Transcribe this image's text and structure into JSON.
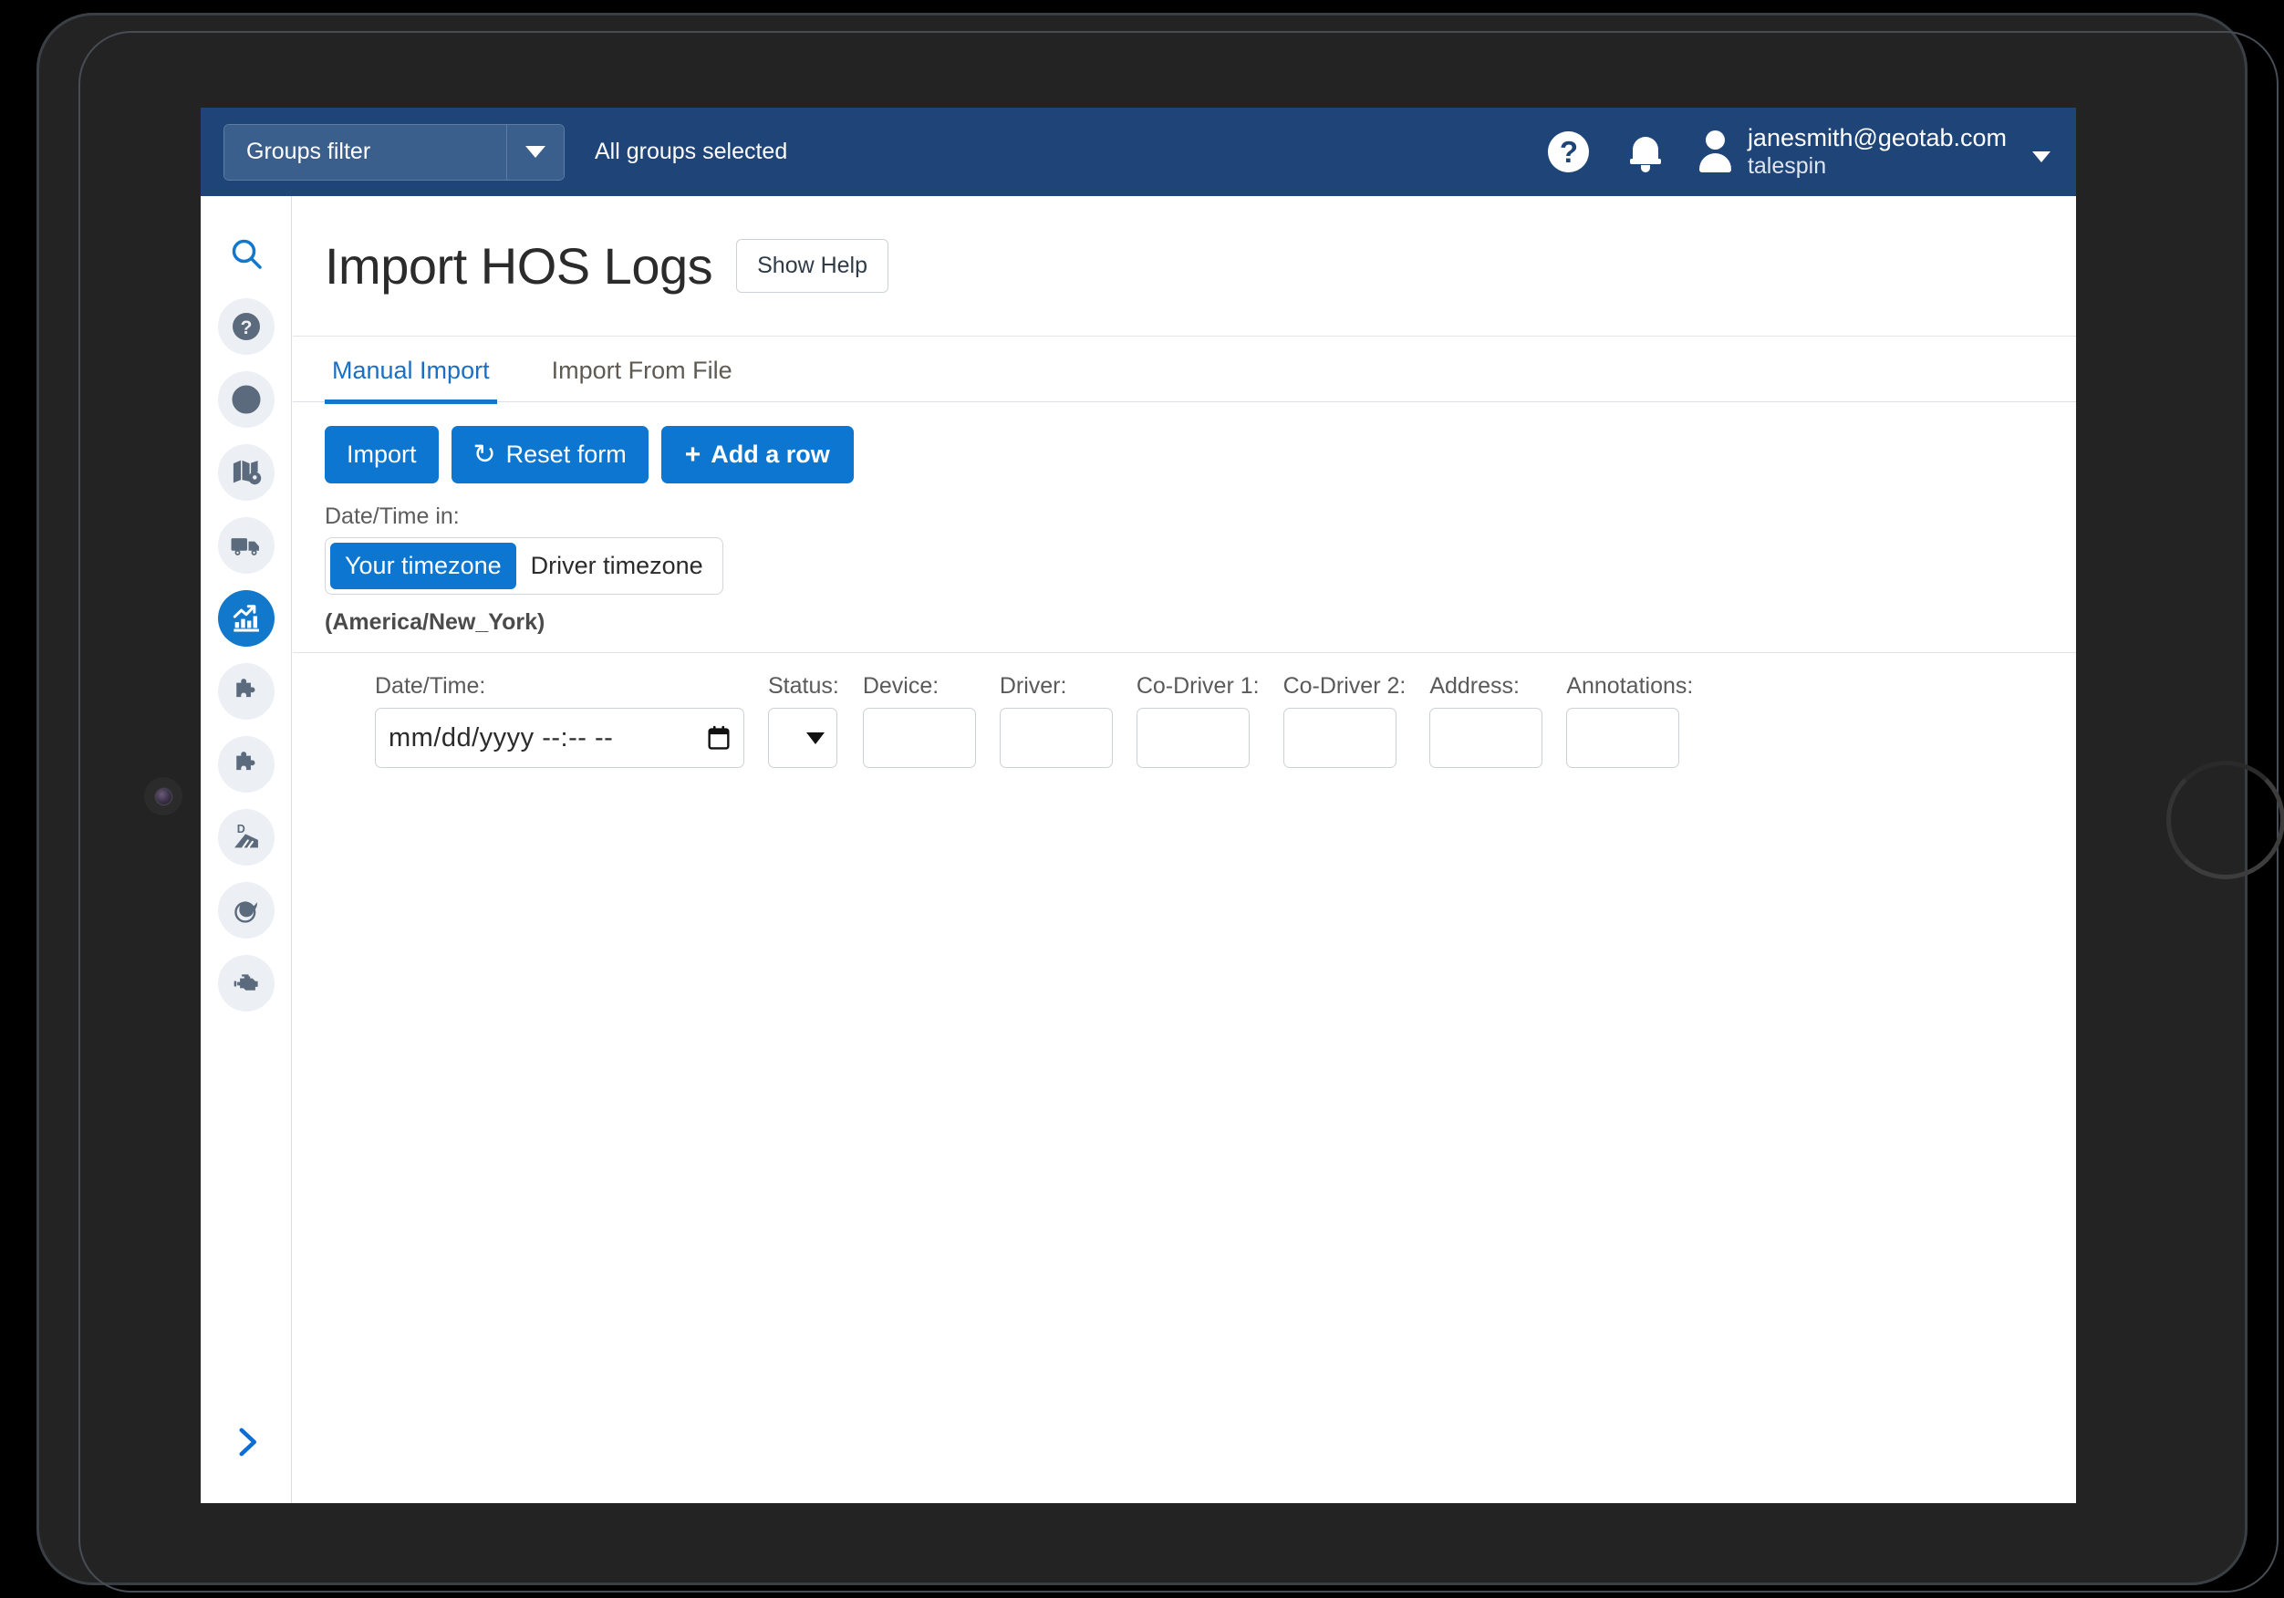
{
  "header": {
    "groups_filter_label": "Groups filter",
    "groups_selected_text": "All groups selected",
    "help_icon": "question-mark-circle-icon",
    "bell_icon": "notification-bell-icon",
    "user_email": "janesmith@geotab.com",
    "user_database": "talespin",
    "accent_blue": "#1f4477"
  },
  "sidebar": {
    "items": [
      {
        "name": "search",
        "icon": "search-icon",
        "active": false,
        "plain": true
      },
      {
        "name": "help",
        "icon": "help-circle-icon",
        "active": false,
        "plain": false
      },
      {
        "name": "dashboard",
        "icon": "pie-chart-icon",
        "active": false,
        "plain": false
      },
      {
        "name": "map",
        "icon": "map-pin-icon",
        "active": false,
        "plain": false
      },
      {
        "name": "vehicles",
        "icon": "truck-icon",
        "active": false,
        "plain": false
      },
      {
        "name": "reports",
        "icon": "bar-chart-up-icon",
        "active": true,
        "plain": false
      },
      {
        "name": "addins-1",
        "icon": "puzzle-piece-icon",
        "active": false,
        "plain": false
      },
      {
        "name": "addins-2",
        "icon": "puzzle-piece-icon",
        "active": false,
        "plain": false
      },
      {
        "name": "driving",
        "icon": "d-road-icon",
        "active": false,
        "plain": false
      },
      {
        "name": "fuel",
        "icon": "fuel-leaf-icon",
        "active": false,
        "plain": false
      },
      {
        "name": "engine",
        "icon": "engine-icon",
        "active": false,
        "plain": false
      }
    ],
    "expand_icon": "chevron-right-icon"
  },
  "page": {
    "title": "Import HOS Logs",
    "show_help_label": "Show Help"
  },
  "tabs": [
    {
      "label": "Manual Import",
      "active": true
    },
    {
      "label": "Import From File",
      "active": false
    }
  ],
  "toolbar": {
    "import_label": "Import",
    "reset_label": "Reset form",
    "reset_icon": "refresh-icon",
    "add_row_label": "Add a row",
    "add_row_icon": "plus-icon",
    "primary_blue": "#0d76d0"
  },
  "timezone": {
    "label": "Date/Time in:",
    "options": [
      {
        "label": "Your timezone",
        "selected": true
      },
      {
        "label": "Driver timezone",
        "selected": false
      }
    ],
    "zone_text": "(America/New_York)"
  },
  "form": {
    "columns": [
      {
        "key": "datetime",
        "label": "Date/Time:",
        "type": "datetime",
        "value": "mm/dd/yyyy --:-- --"
      },
      {
        "key": "status",
        "label": "Status:",
        "type": "select",
        "value": ""
      },
      {
        "key": "device",
        "label": "Device:",
        "type": "text",
        "value": ""
      },
      {
        "key": "driver",
        "label": "Driver:",
        "type": "text",
        "value": ""
      },
      {
        "key": "codriver1",
        "label": "Co-Driver 1:",
        "type": "text",
        "value": ""
      },
      {
        "key": "codriver2",
        "label": "Co-Driver 2:",
        "type": "text",
        "value": ""
      },
      {
        "key": "address",
        "label": "Address:",
        "type": "text",
        "value": ""
      },
      {
        "key": "annotations",
        "label": "Annotations:",
        "type": "text",
        "value": ""
      }
    ]
  }
}
